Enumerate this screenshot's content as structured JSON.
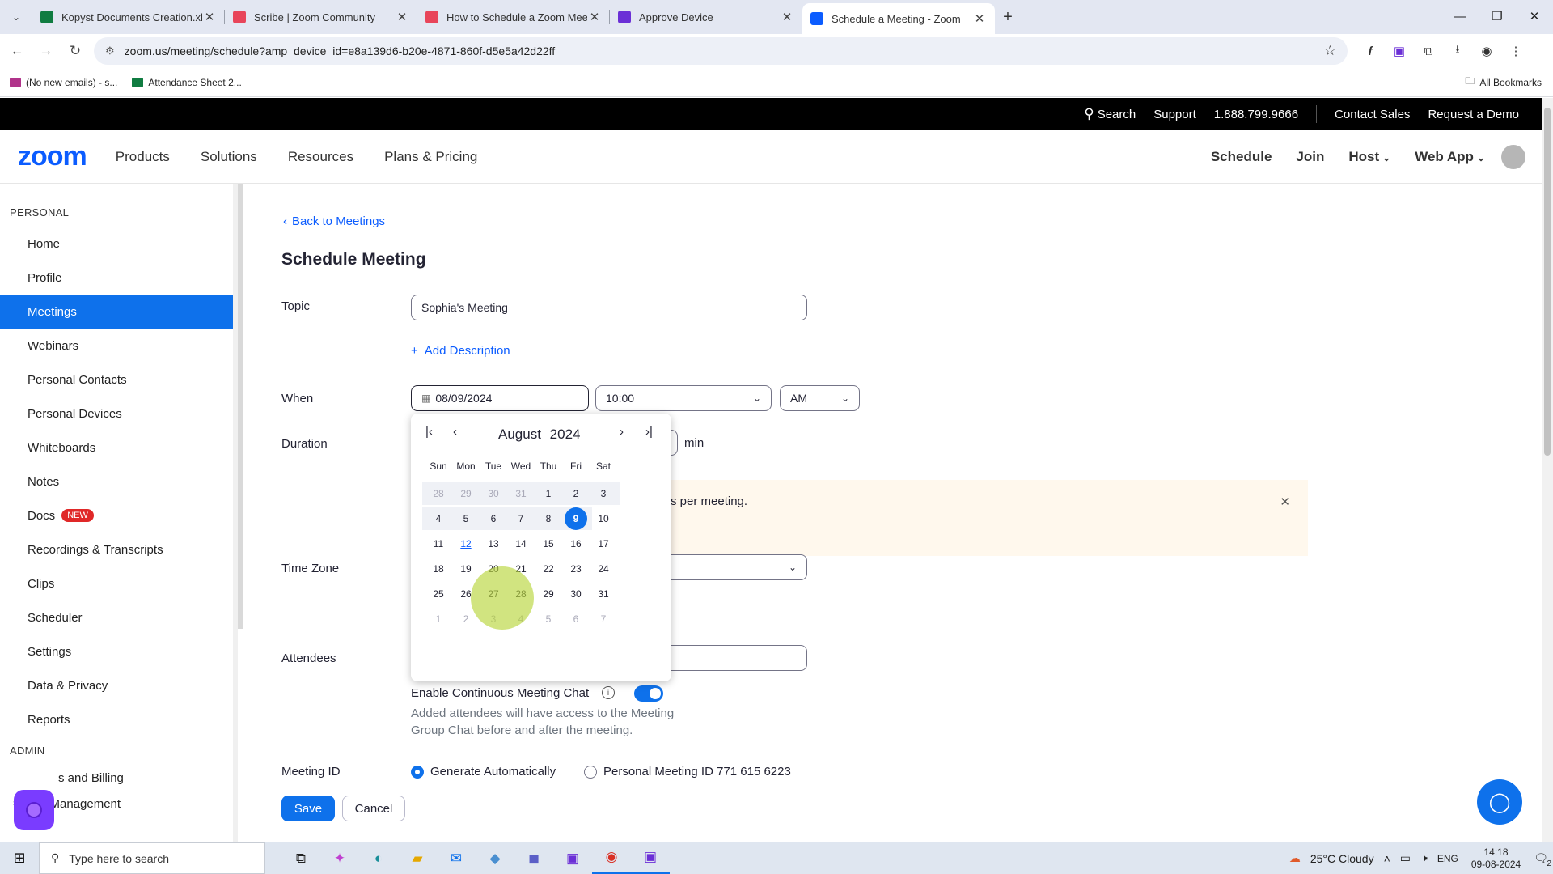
{
  "browser": {
    "tabs": [
      {
        "title": "Kopyst Documents Creation.xlsx",
        "icon": "excel-icon",
        "color": "#107c41"
      },
      {
        "title": "Scribe | Zoom Community",
        "icon": "scribe-icon",
        "color": "#e8455a"
      },
      {
        "title": "How to Schedule a Zoom Meet",
        "icon": "scribe-icon",
        "color": "#e8455a"
      },
      {
        "title": "Approve Device",
        "icon": "kopyst-icon",
        "color": "#6b2fd6"
      },
      {
        "title": "Schedule a Meeting - Zoom",
        "icon": "zoom-icon",
        "color": "#0b5cff"
      }
    ],
    "url": "zoom.us/meeting/schedule?amp_device_id=e8a139d6-b20e-4871-860f-d5e5a42d22ff",
    "bookmarks": [
      {
        "label": "(No new emails) - s...",
        "color": "#b0338a"
      },
      {
        "label": "Attendance Sheet 2...",
        "color": "#107c41"
      }
    ],
    "all_bookmarks": "All Bookmarks"
  },
  "topbar": {
    "search": "Search",
    "support": "Support",
    "phone": "1.888.799.9666",
    "contact": "Contact Sales",
    "demo": "Request a Demo"
  },
  "nav": {
    "logo": "zoom",
    "left": [
      "Products",
      "Solutions",
      "Resources",
      "Plans & Pricing"
    ],
    "schedule": "Schedule",
    "join": "Join",
    "host": "Host",
    "webapp": "Web App"
  },
  "sidebar": {
    "personal_heading": "PERSONAL",
    "items": [
      "Home",
      "Profile",
      "Meetings",
      "Webinars",
      "Personal Contacts",
      "Personal Devices",
      "Whiteboards",
      "Notes",
      "Docs",
      "Recordings & Transcripts",
      "Clips",
      "Scheduler",
      "Settings",
      "Data & Privacy",
      "Reports"
    ],
    "docs_badge": "NEW",
    "admin_heading": "ADMIN",
    "admin_items": [
      "s and Billing",
      "User Management"
    ]
  },
  "form": {
    "back": "Back to Meetings",
    "title": "Schedule Meeting",
    "topic_label": "Topic",
    "topic_value": "Sophia's Meeting",
    "add_description": "Add Description",
    "when_label": "When",
    "date": "08/09/2024",
    "time": "10:00",
    "ampm": "AM",
    "duration_label": "Duration",
    "min": "min",
    "warning_text": "s per meeting.",
    "timezone_label": "Time Zone",
    "attendees_label": "Attendees",
    "chat_label": "Enable Continuous Meeting Chat",
    "chat_note_1": "Added attendees will have access to the Meeting",
    "chat_note_2": "Group Chat before and after the meeting.",
    "meeting_id_label": "Meeting ID",
    "gen_auto": "Generate Automatically",
    "pmi": "Personal Meeting ID 771 615 6223",
    "save": "Save",
    "cancel": "Cancel"
  },
  "calendar": {
    "month": "August",
    "year": "2024",
    "weekdays": [
      "Sun",
      "Mon",
      "Tue",
      "Wed",
      "Thu",
      "Fri",
      "Sat"
    ],
    "weeks": [
      [
        "28",
        "29",
        "30",
        "31",
        "1",
        "2",
        "3"
      ],
      [
        "4",
        "5",
        "6",
        "7",
        "8",
        "9",
        "10"
      ],
      [
        "11",
        "12",
        "13",
        "14",
        "15",
        "16",
        "17"
      ],
      [
        "18",
        "19",
        "20",
        "21",
        "22",
        "23",
        "24"
      ],
      [
        "25",
        "26",
        "27",
        "28",
        "29",
        "30",
        "31"
      ],
      [
        "1",
        "2",
        "3",
        "4",
        "5",
        "6",
        "7"
      ]
    ],
    "selected": "9",
    "today": "12"
  },
  "taskbar": {
    "search_placeholder": "Type here to search",
    "weather": "25°C  Cloudy",
    "lang": "ENG",
    "time": "14:18",
    "date": "09-08-2024",
    "notif_count": "2"
  }
}
